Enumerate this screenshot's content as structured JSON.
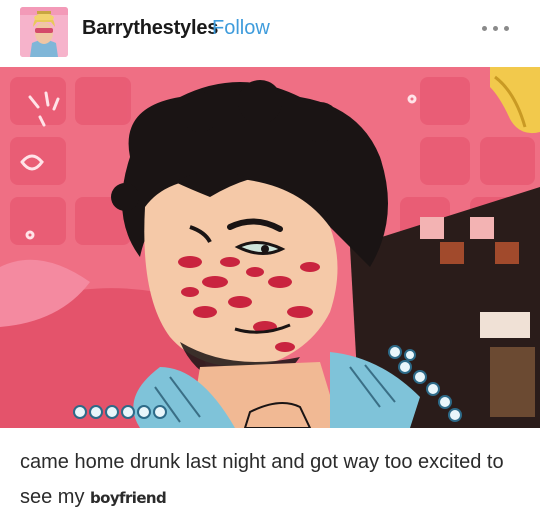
{
  "post": {
    "username": "Barrythestyles",
    "follow_label": "Follow",
    "more_icon": "more-horizontal-icon",
    "image_alt": "Illustration of a curly-haired man with lipstick kiss marks on his face",
    "caption_main": "came home drunk last night and got way too excited to see my",
    "caption_small": "boyfriend"
  },
  "colors": {
    "follow": "#3f9cdc",
    "background": "#ffffff",
    "image_pink": "#ef6f84"
  }
}
